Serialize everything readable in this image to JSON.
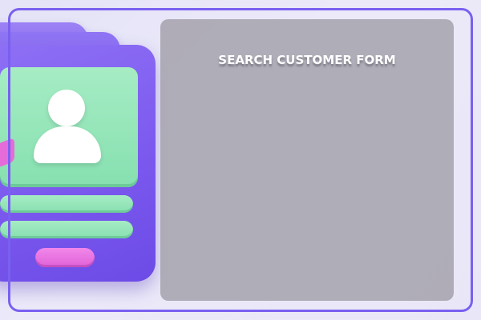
{
  "form": {
    "title": "SEARCH CUSTOMER FORM"
  },
  "colors": {
    "frame": "#7a60f0",
    "card": "#7a58ee",
    "panel": "#a6a4ae",
    "accent_green": "#86e0b0",
    "accent_pink": "#e062d8"
  },
  "icons": {
    "illustration": "customer-profile-card-icon",
    "avatar": "user-avatar-icon"
  }
}
